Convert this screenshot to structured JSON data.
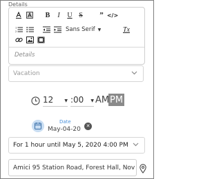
{
  "section_label": "Details",
  "editor": {
    "font_family_value": "Sans Serif",
    "placeholder": "Details",
    "icons": [
      "text-color-icon",
      "background-color-icon",
      "bold-icon",
      "italic-icon",
      "underline-icon",
      "strike-icon",
      "quote-icon",
      "code-icon",
      "ordered-list-icon",
      "bullet-list-icon",
      "outdent-icon",
      "indent-icon",
      "clear-format-icon",
      "link-icon",
      "image-icon",
      "video-icon"
    ],
    "bold": "B",
    "italic": "I",
    "underline": "U",
    "strike": "S",
    "quote": "”",
    "code": "</>",
    "clear": "Tx"
  },
  "type_select": {
    "placeholder": "Vacation"
  },
  "time": {
    "hour": "12",
    "minute": ":00",
    "am": "AM",
    "pm": "PM",
    "selected": "PM"
  },
  "date_chip": {
    "label": "Date",
    "value": "May-04-20"
  },
  "duration_select": {
    "value": "For 1 hour until May 5, 2020 4:00 PM"
  },
  "location": {
    "value": "Amici 95 Station Road, Forest Hall, Nov"
  },
  "colors": {
    "accent": "#4a90d9",
    "pm_selected_bg": "#8a8a8a",
    "border": "#cfcfcf"
  }
}
